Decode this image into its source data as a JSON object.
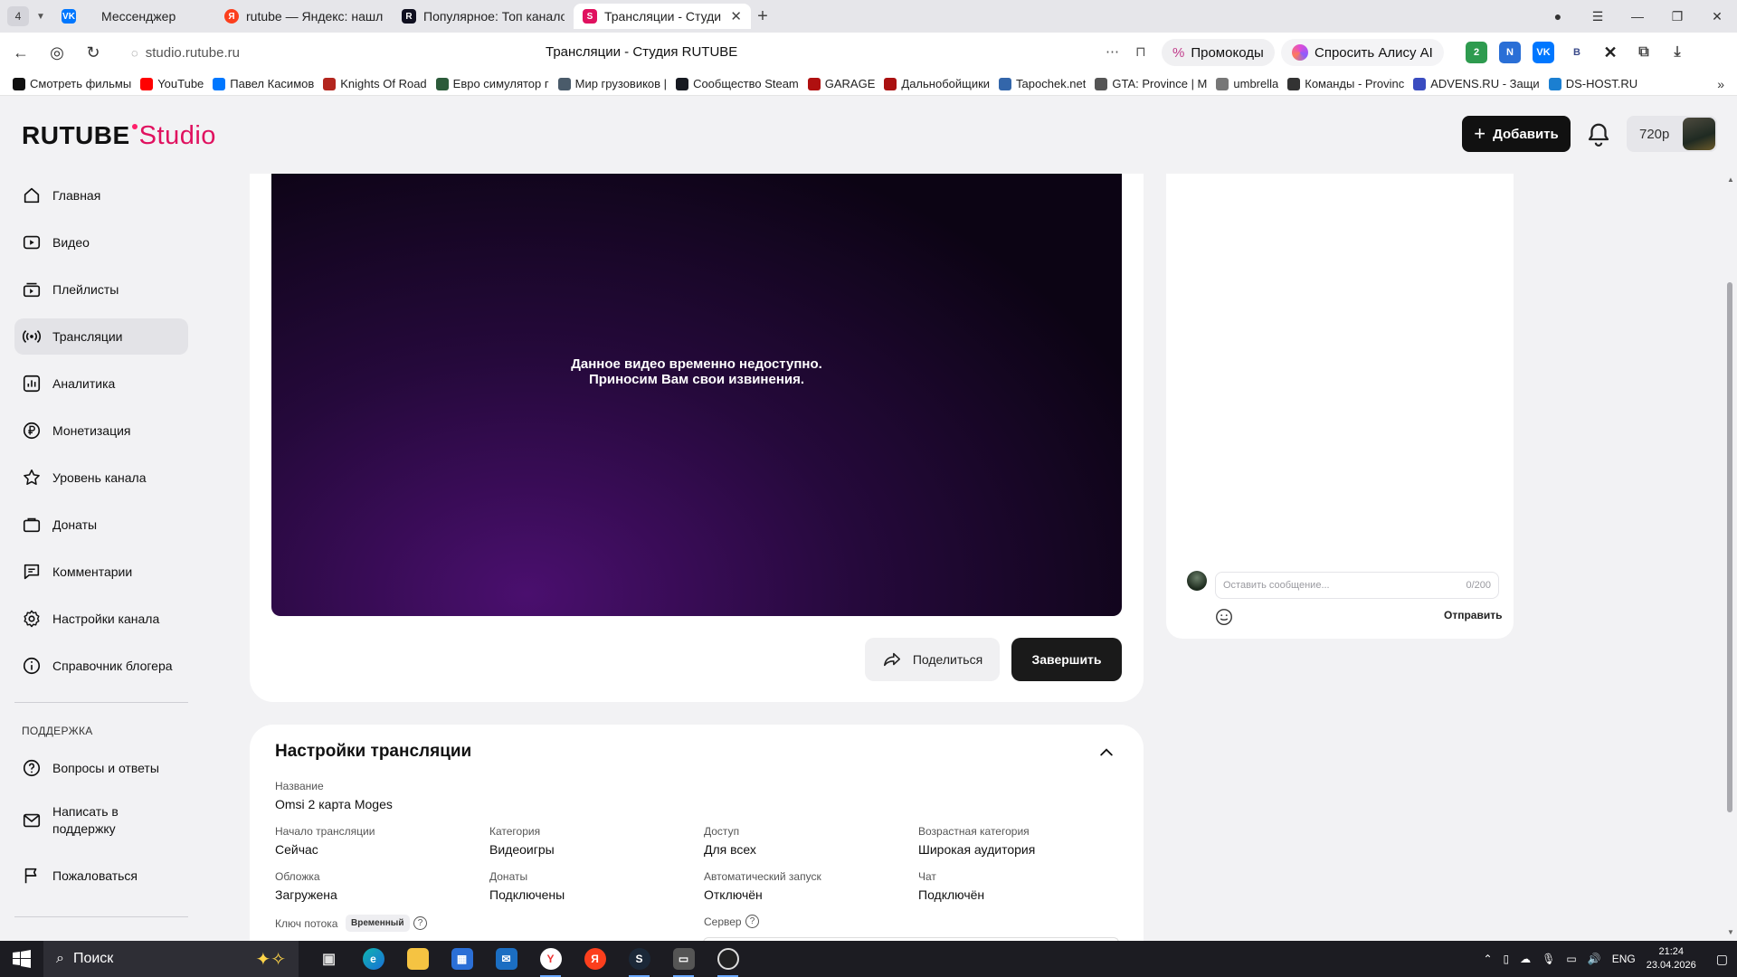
{
  "browser": {
    "tab_count": "4",
    "tabs": [
      {
        "title": "Мессенджер",
        "icon": "vk-icon",
        "color": "#0077ff"
      },
      {
        "title": "rutube — Яндекс: нашлось",
        "icon": "yandex-icon",
        "color": "#fc3f1d"
      },
      {
        "title": "Популярное: Топ каналов",
        "icon": "rutube-icon",
        "color": "#101020"
      },
      {
        "title": "Трансляции - Студия RUTUBE",
        "icon": "rutube-studio-icon",
        "color": "#e0115f"
      }
    ],
    "url_host": "studio.rutube.ru",
    "page_title": "Трансляции - Студия RUTUBE",
    "promo_label": "Промокоды",
    "alice_label": "Спросить Алису AI",
    "bookmarks": [
      {
        "label": "Смотреть фильмы",
        "color": "#111"
      },
      {
        "label": "YouTube",
        "color": "#ff0000"
      },
      {
        "label": "Павел Касимов",
        "color": "#0077ff"
      },
      {
        "label": "Knights Of Road",
        "color": "#b3261e"
      },
      {
        "label": "Евро симулятор г",
        "color": "#2c5b3a"
      },
      {
        "label": "Мир грузовиков |",
        "color": "#4a5b6a"
      },
      {
        "label": "Сообщество Steam",
        "color": "#171a21"
      },
      {
        "label": "GARAGE",
        "color": "#b01010"
      },
      {
        "label": "Дальнобойщики",
        "color": "#a11"
      },
      {
        "label": "Tapochek.net",
        "color": "#3366aa"
      },
      {
        "label": "GTA: Province | M",
        "color": "#555"
      },
      {
        "label": "umbrella",
        "color": "#777"
      },
      {
        "label": "Команды - Provinc",
        "color": "#333"
      },
      {
        "label": "ADVENS.RU - Защи",
        "color": "#3a4cc0"
      },
      {
        "label": "DS-HOST.RU",
        "color": "#1b7fd1"
      }
    ]
  },
  "studio": {
    "logo_main": "RUTUBE",
    "logo_studio": "Studio",
    "add_button": "Добавить",
    "quality": "720p"
  },
  "sidebar": {
    "items": [
      {
        "label": "Главная",
        "icon": "home-icon"
      },
      {
        "label": "Видео",
        "icon": "video-icon"
      },
      {
        "label": "Плейлисты",
        "icon": "playlist-icon"
      },
      {
        "label": "Трансляции",
        "icon": "broadcast-icon"
      },
      {
        "label": "Аналитика",
        "icon": "analytics-icon"
      },
      {
        "label": "Монетизация",
        "icon": "ruble-icon"
      },
      {
        "label": "Уровень канала",
        "icon": "star-icon"
      },
      {
        "label": "Донаты",
        "icon": "wallet-icon"
      },
      {
        "label": "Комментарии",
        "icon": "comment-icon"
      },
      {
        "label": "Настройки канала",
        "icon": "gear-icon"
      },
      {
        "label": "Справочник блогера",
        "icon": "info-icon"
      }
    ],
    "support_heading": "ПОДДЕРЖКА",
    "support_items": [
      {
        "label": "Вопросы и ответы",
        "icon": "question-icon"
      },
      {
        "label": "Написать в поддержку",
        "icon": "mail-icon"
      },
      {
        "label": "Пожаловаться",
        "icon": "flag-icon"
      }
    ]
  },
  "player": {
    "message_line1": "Данное видео временно недоступно.",
    "message_line2": "Приносим Вам свои извинения.",
    "share_button": "Поделиться",
    "finish_button": "Завершить"
  },
  "chat": {
    "placeholder": "Оставить сообщение...",
    "counter": "0/200",
    "send_button": "Отправить"
  },
  "settings": {
    "title": "Настройки трансляции",
    "name_label": "Название",
    "name_value": "Omsi 2 карта Moges",
    "fields_row1": [
      {
        "label": "Начало трансляции",
        "value": "Сейчас"
      },
      {
        "label": "Категория",
        "value": "Видеоигры"
      },
      {
        "label": "Доступ",
        "value": "Для всех"
      },
      {
        "label": "Возрастная категория",
        "value": "Широкая аудитория"
      }
    ],
    "fields_row2": [
      {
        "label": "Обложка",
        "value": "Загружена"
      },
      {
        "label": "Донаты",
        "value": "Подключены"
      },
      {
        "label": "Автоматический запуск",
        "value": "Отключён"
      },
      {
        "label": "Чат",
        "value": "Подключён"
      }
    ],
    "stream_key_label": "Ключ потока",
    "stream_key_badge": "Временный",
    "server_label": "Сервер"
  },
  "taskbar": {
    "search_label": "Поиск",
    "lang": "ENG",
    "time": "21:24",
    "date": "23.04.2026"
  }
}
